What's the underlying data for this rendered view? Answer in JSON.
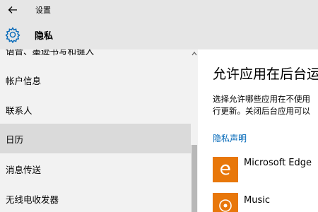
{
  "window": {
    "title": "设置"
  },
  "header": {
    "title": "隐私"
  },
  "sidebar": {
    "items": [
      {
        "label": "语音、墨迹书写和键入"
      },
      {
        "label": "帐户信息"
      },
      {
        "label": "联系人"
      },
      {
        "label": "日历",
        "selected": true
      },
      {
        "label": "消息传送"
      },
      {
        "label": "无线电收发器"
      }
    ]
  },
  "main": {
    "title": "允许应用在后台运行",
    "description_lines": [
      "选择允许哪些应用在不使用",
      "行更新。关闭后台应用可以"
    ],
    "privacy_link": "隐私声明",
    "apps": [
      {
        "name": "Microsoft Edge",
        "icon": "edge-icon"
      },
      {
        "name": "Music",
        "icon": "music-icon"
      }
    ]
  },
  "colors": {
    "accent": "#0067b8",
    "app_tile": "#e8770a",
    "chrome": "#e6e6e6",
    "sidebar": "#f2f2f2",
    "selected": "#dadada"
  }
}
